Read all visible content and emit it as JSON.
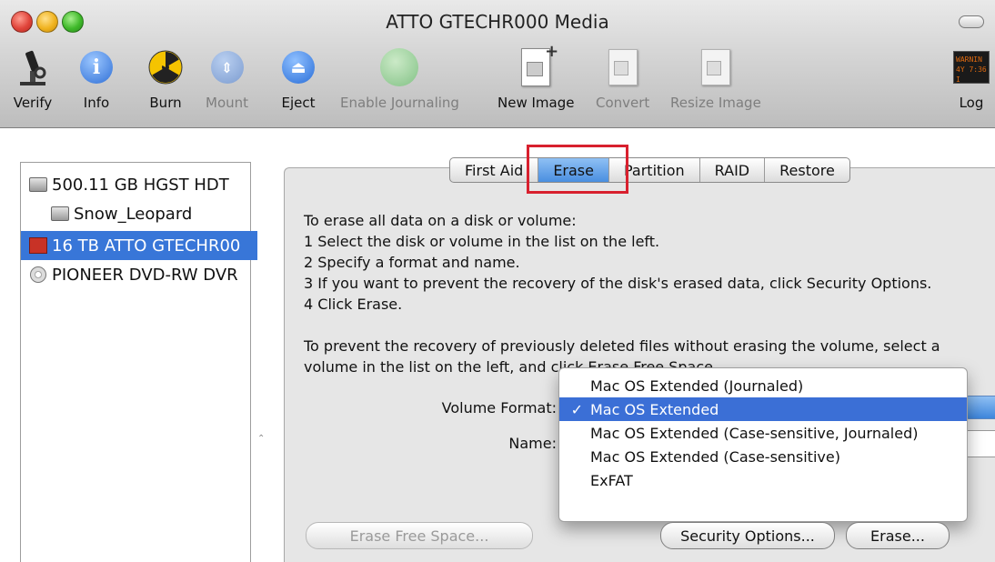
{
  "window": {
    "title": "ATTO GTECHR000 Media"
  },
  "toolbar": {
    "items": [
      {
        "label": "Verify",
        "icon": "microscope-icon",
        "enabled": true
      },
      {
        "label": "Info",
        "icon": "info-icon",
        "enabled": true
      },
      {
        "label": "Burn",
        "icon": "burn-icon",
        "enabled": true
      },
      {
        "label": "Mount",
        "icon": "mount-icon",
        "enabled": false
      },
      {
        "label": "Eject",
        "icon": "eject-icon",
        "enabled": true
      },
      {
        "label": "Enable Journaling",
        "icon": "journaling-icon",
        "enabled": false
      },
      {
        "label": "New Image",
        "icon": "new-image-icon",
        "enabled": true
      },
      {
        "label": "Convert",
        "icon": "convert-icon",
        "enabled": false
      },
      {
        "label": "Resize Image",
        "icon": "resize-image-icon",
        "enabled": false
      },
      {
        "label": "Log",
        "icon": "log-icon",
        "enabled": true
      }
    ],
    "log_icon_text": [
      "WARNIN",
      "4Y 7:36 I"
    ]
  },
  "sidebar": {
    "items": [
      {
        "label": "500.11 GB  HGST  HDT",
        "icon": "hard-disk-icon",
        "selected": false
      },
      {
        "label": "Snow_Leopard",
        "icon": "volume-icon",
        "selected": false
      },
      {
        "label": "16 TB ATTO GTECHR00",
        "icon": "raid-disk-icon",
        "selected": true
      },
      {
        "label": "PIONEER DVD-RW DVR",
        "icon": "optical-drive-icon",
        "selected": false
      }
    ]
  },
  "tabs": [
    {
      "label": "First Aid",
      "active": false
    },
    {
      "label": "Erase",
      "active": true
    },
    {
      "label": "Partition",
      "active": false
    },
    {
      "label": "RAID",
      "active": false
    },
    {
      "label": "Restore",
      "active": false
    }
  ],
  "instructions": {
    "lines": [
      "To erase all data on a disk or volume:",
      "1 Select the disk or volume in the list on the left.",
      "2 Specify a format and name.",
      "3 If you want to prevent the recovery of the disk's erased data, click Security Options.",
      "4 Click Erase."
    ],
    "free_space_lines": [
      "To prevent the recovery of previously deleted files without erasing the volume, select a",
      "volume in the list on the left, and click Erase Free Space."
    ]
  },
  "form": {
    "volume_format_label": "Volume Format:",
    "name_label": "Name:"
  },
  "format_menu": {
    "options": [
      {
        "label": "Mac OS Extended (Journaled)",
        "checked": false
      },
      {
        "label": "Mac OS Extended",
        "checked": true
      },
      {
        "label": "Mac OS Extended (Case-sensitive, Journaled)",
        "checked": false
      },
      {
        "label": "Mac OS Extended (Case-sensitive)",
        "checked": false
      },
      {
        "label": "ExFAT",
        "checked": false
      }
    ],
    "check_mark": "✓"
  },
  "buttons": {
    "erase_free_space": "Erase Free Space...",
    "security_options": "Security Options...",
    "erase": "Erase..."
  },
  "colors": {
    "selection": "#3876d8",
    "annotation": "#d8202e"
  }
}
